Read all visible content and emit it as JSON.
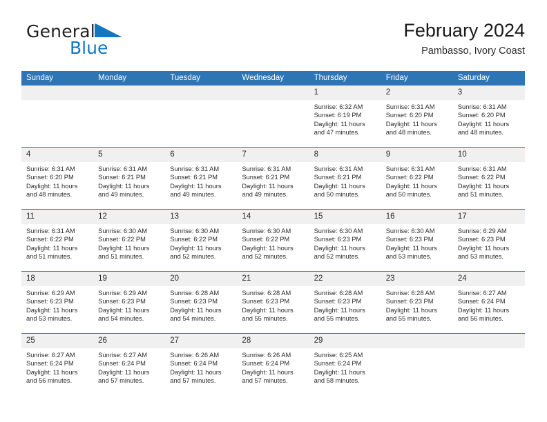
{
  "brand": {
    "name_top": "General",
    "name_bottom": "Blue",
    "triangle_icon": "blue-triangle-icon",
    "color_top": "#231f20",
    "color_bottom": "#1277c0"
  },
  "header": {
    "title": "February 2024",
    "subtitle": "Pambasso, Ivory Coast"
  },
  "theme": {
    "header_blue": "#2e75b6",
    "daynum_gray": "#f0f0f0",
    "text": "#2b2b2b"
  },
  "calendar": {
    "weekday_headers": [
      "Sunday",
      "Monday",
      "Tuesday",
      "Wednesday",
      "Thursday",
      "Friday",
      "Saturday"
    ],
    "labels": {
      "sunrise": "Sunrise:",
      "sunset": "Sunset:",
      "daylight": "Daylight:"
    },
    "weeks": [
      [
        {
          "day": "",
          "blank": true
        },
        {
          "day": "",
          "blank": true
        },
        {
          "day": "",
          "blank": true
        },
        {
          "day": "",
          "blank": true
        },
        {
          "day": "1",
          "sunrise": "Sunrise: 6:32 AM",
          "sunset": "Sunset: 6:19 PM",
          "daylight_l1": "Daylight: 11 hours",
          "daylight_l2": "and 47 minutes."
        },
        {
          "day": "2",
          "sunrise": "Sunrise: 6:31 AM",
          "sunset": "Sunset: 6:20 PM",
          "daylight_l1": "Daylight: 11 hours",
          "daylight_l2": "and 48 minutes."
        },
        {
          "day": "3",
          "sunrise": "Sunrise: 6:31 AM",
          "sunset": "Sunset: 6:20 PM",
          "daylight_l1": "Daylight: 11 hours",
          "daylight_l2": "and 48 minutes."
        }
      ],
      [
        {
          "day": "4",
          "sunrise": "Sunrise: 6:31 AM",
          "sunset": "Sunset: 6:20 PM",
          "daylight_l1": "Daylight: 11 hours",
          "daylight_l2": "and 48 minutes."
        },
        {
          "day": "5",
          "sunrise": "Sunrise: 6:31 AM",
          "sunset": "Sunset: 6:21 PM",
          "daylight_l1": "Daylight: 11 hours",
          "daylight_l2": "and 49 minutes."
        },
        {
          "day": "6",
          "sunrise": "Sunrise: 6:31 AM",
          "sunset": "Sunset: 6:21 PM",
          "daylight_l1": "Daylight: 11 hours",
          "daylight_l2": "and 49 minutes."
        },
        {
          "day": "7",
          "sunrise": "Sunrise: 6:31 AM",
          "sunset": "Sunset: 6:21 PM",
          "daylight_l1": "Daylight: 11 hours",
          "daylight_l2": "and 49 minutes."
        },
        {
          "day": "8",
          "sunrise": "Sunrise: 6:31 AM",
          "sunset": "Sunset: 6:21 PM",
          "daylight_l1": "Daylight: 11 hours",
          "daylight_l2": "and 50 minutes."
        },
        {
          "day": "9",
          "sunrise": "Sunrise: 6:31 AM",
          "sunset": "Sunset: 6:22 PM",
          "daylight_l1": "Daylight: 11 hours",
          "daylight_l2": "and 50 minutes."
        },
        {
          "day": "10",
          "sunrise": "Sunrise: 6:31 AM",
          "sunset": "Sunset: 6:22 PM",
          "daylight_l1": "Daylight: 11 hours",
          "daylight_l2": "and 51 minutes."
        }
      ],
      [
        {
          "day": "11",
          "sunrise": "Sunrise: 6:31 AM",
          "sunset": "Sunset: 6:22 PM",
          "daylight_l1": "Daylight: 11 hours",
          "daylight_l2": "and 51 minutes."
        },
        {
          "day": "12",
          "sunrise": "Sunrise: 6:30 AM",
          "sunset": "Sunset: 6:22 PM",
          "daylight_l1": "Daylight: 11 hours",
          "daylight_l2": "and 51 minutes."
        },
        {
          "day": "13",
          "sunrise": "Sunrise: 6:30 AM",
          "sunset": "Sunset: 6:22 PM",
          "daylight_l1": "Daylight: 11 hours",
          "daylight_l2": "and 52 minutes."
        },
        {
          "day": "14",
          "sunrise": "Sunrise: 6:30 AM",
          "sunset": "Sunset: 6:22 PM",
          "daylight_l1": "Daylight: 11 hours",
          "daylight_l2": "and 52 minutes."
        },
        {
          "day": "15",
          "sunrise": "Sunrise: 6:30 AM",
          "sunset": "Sunset: 6:23 PM",
          "daylight_l1": "Daylight: 11 hours",
          "daylight_l2": "and 52 minutes."
        },
        {
          "day": "16",
          "sunrise": "Sunrise: 6:30 AM",
          "sunset": "Sunset: 6:23 PM",
          "daylight_l1": "Daylight: 11 hours",
          "daylight_l2": "and 53 minutes."
        },
        {
          "day": "17",
          "sunrise": "Sunrise: 6:29 AM",
          "sunset": "Sunset: 6:23 PM",
          "daylight_l1": "Daylight: 11 hours",
          "daylight_l2": "and 53 minutes."
        }
      ],
      [
        {
          "day": "18",
          "sunrise": "Sunrise: 6:29 AM",
          "sunset": "Sunset: 6:23 PM",
          "daylight_l1": "Daylight: 11 hours",
          "daylight_l2": "and 53 minutes."
        },
        {
          "day": "19",
          "sunrise": "Sunrise: 6:29 AM",
          "sunset": "Sunset: 6:23 PM",
          "daylight_l1": "Daylight: 11 hours",
          "daylight_l2": "and 54 minutes."
        },
        {
          "day": "20",
          "sunrise": "Sunrise: 6:28 AM",
          "sunset": "Sunset: 6:23 PM",
          "daylight_l1": "Daylight: 11 hours",
          "daylight_l2": "and 54 minutes."
        },
        {
          "day": "21",
          "sunrise": "Sunrise: 6:28 AM",
          "sunset": "Sunset: 6:23 PM",
          "daylight_l1": "Daylight: 11 hours",
          "daylight_l2": "and 55 minutes."
        },
        {
          "day": "22",
          "sunrise": "Sunrise: 6:28 AM",
          "sunset": "Sunset: 6:23 PM",
          "daylight_l1": "Daylight: 11 hours",
          "daylight_l2": "and 55 minutes."
        },
        {
          "day": "23",
          "sunrise": "Sunrise: 6:28 AM",
          "sunset": "Sunset: 6:23 PM",
          "daylight_l1": "Daylight: 11 hours",
          "daylight_l2": "and 55 minutes."
        },
        {
          "day": "24",
          "sunrise": "Sunrise: 6:27 AM",
          "sunset": "Sunset: 6:24 PM",
          "daylight_l1": "Daylight: 11 hours",
          "daylight_l2": "and 56 minutes."
        }
      ],
      [
        {
          "day": "25",
          "sunrise": "Sunrise: 6:27 AM",
          "sunset": "Sunset: 6:24 PM",
          "daylight_l1": "Daylight: 11 hours",
          "daylight_l2": "and 56 minutes."
        },
        {
          "day": "26",
          "sunrise": "Sunrise: 6:27 AM",
          "sunset": "Sunset: 6:24 PM",
          "daylight_l1": "Daylight: 11 hours",
          "daylight_l2": "and 57 minutes."
        },
        {
          "day": "27",
          "sunrise": "Sunrise: 6:26 AM",
          "sunset": "Sunset: 6:24 PM",
          "daylight_l1": "Daylight: 11 hours",
          "daylight_l2": "and 57 minutes."
        },
        {
          "day": "28",
          "sunrise": "Sunrise: 6:26 AM",
          "sunset": "Sunset: 6:24 PM",
          "daylight_l1": "Daylight: 11 hours",
          "daylight_l2": "and 57 minutes."
        },
        {
          "day": "29",
          "sunrise": "Sunrise: 6:25 AM",
          "sunset": "Sunset: 6:24 PM",
          "daylight_l1": "Daylight: 11 hours",
          "daylight_l2": "and 58 minutes."
        },
        {
          "day": "",
          "blank": true
        },
        {
          "day": "",
          "blank": true
        }
      ]
    ]
  }
}
